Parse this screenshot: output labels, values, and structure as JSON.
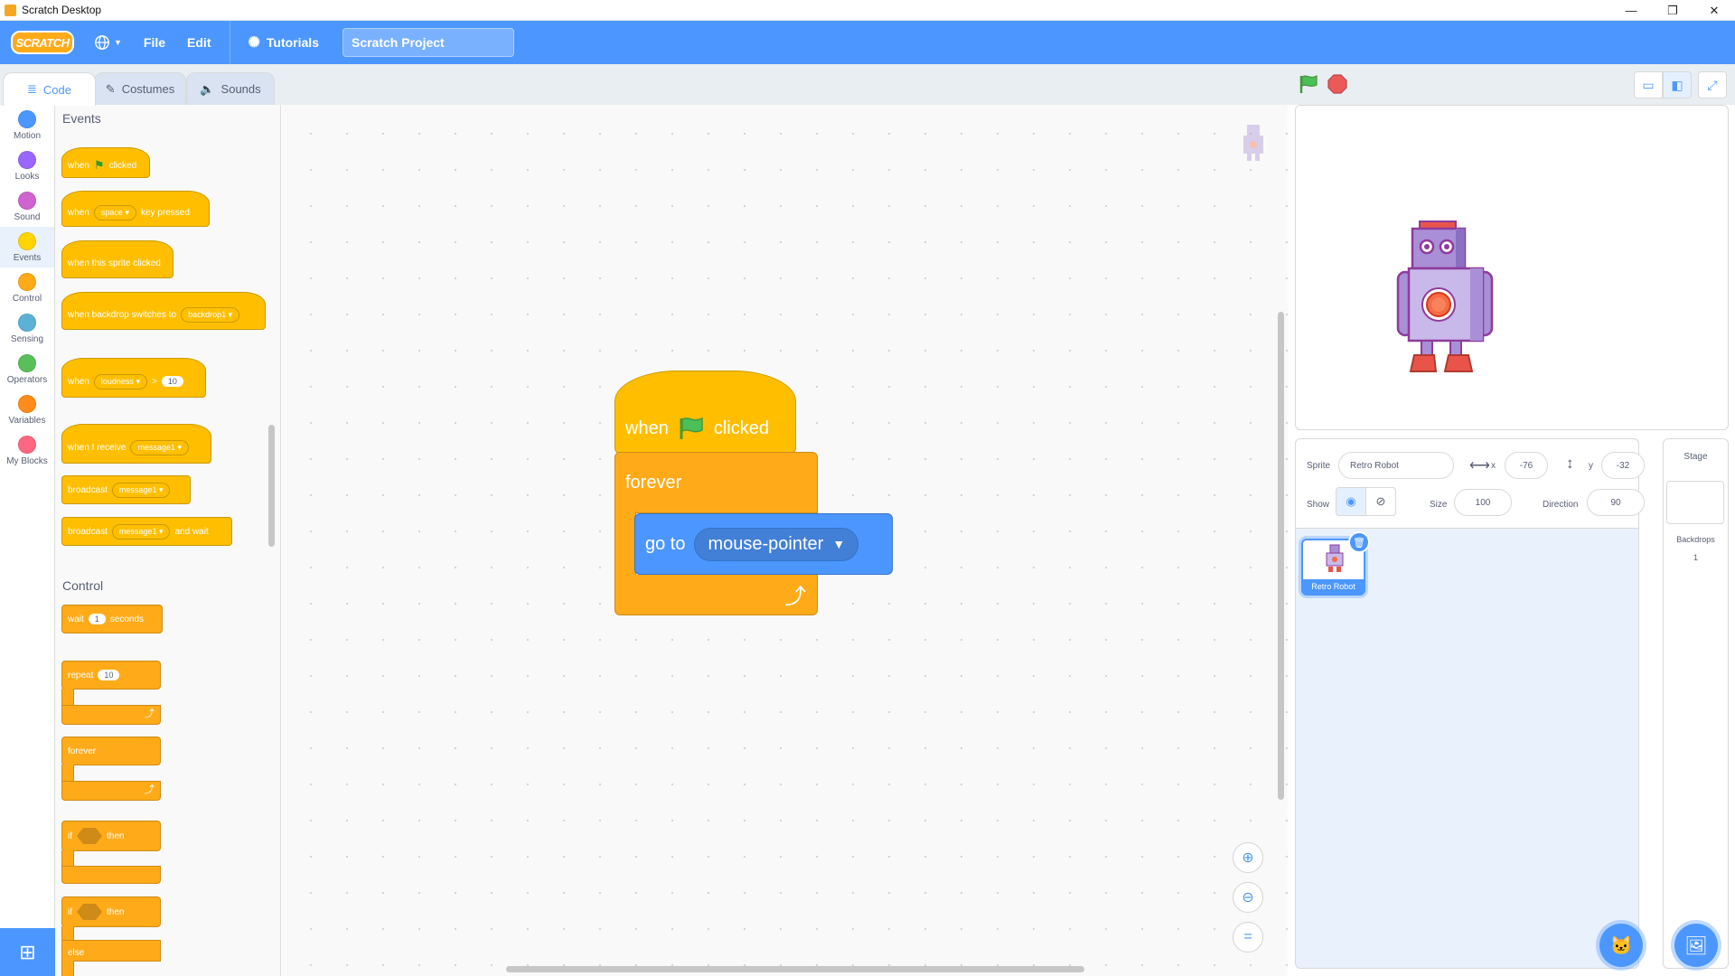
{
  "window": {
    "title": "Scratch Desktop",
    "minimize": "—",
    "restore": "❐",
    "close": "✕"
  },
  "menubar": {
    "logo": "SCRATCH",
    "file": "File",
    "edit": "Edit",
    "tutorials": "Tutorials",
    "project_title": "Scratch Project"
  },
  "tabs": {
    "code": "Code",
    "costumes": "Costumes",
    "sounds": "Sounds"
  },
  "categories": [
    {
      "label": "Motion",
      "color": "#4c97ff"
    },
    {
      "label": "Looks",
      "color": "#9966ff"
    },
    {
      "label": "Sound",
      "color": "#cf63cf"
    },
    {
      "label": "Events",
      "color": "#ffd500"
    },
    {
      "label": "Control",
      "color": "#ffab19"
    },
    {
      "label": "Sensing",
      "color": "#5cb1d6"
    },
    {
      "label": "Operators",
      "color": "#59c059"
    },
    {
      "label": "Variables",
      "color": "#ff8c1a"
    },
    {
      "label": "My Blocks",
      "color": "#ff6680"
    }
  ],
  "palette": {
    "events_title": "Events",
    "control_title": "Control",
    "when": "when",
    "clicked": "clicked",
    "space": "space",
    "key_pressed": "key pressed",
    "when_sprite_clicked": "when this sprite clicked",
    "when_backdrop_switches": "when backdrop switches to",
    "backdrop1": "backdrop1",
    "loudness": "loudness",
    "gt": ">",
    "ten": "10",
    "when_i_receive": "when I receive",
    "message1": "message1",
    "broadcast": "broadcast",
    "and_wait": "and wait",
    "wait": "wait",
    "one": "1",
    "seconds": "seconds",
    "repeat": "repeat",
    "forever": "forever",
    "if": "if",
    "then": "then",
    "else": "else"
  },
  "script": {
    "when": "when",
    "clicked": "clicked",
    "forever": "forever",
    "go_to": "go to",
    "target": "mouse-pointer"
  },
  "sprite_info": {
    "sprite_label": "Sprite",
    "sprite_name": "Retro Robot",
    "x_label": "x",
    "x_value": "-76",
    "y_label": "y",
    "y_value": "-32",
    "show_label": "Show",
    "size_label": "Size",
    "size_value": "100",
    "direction_label": "Direction",
    "direction_value": "90"
  },
  "sprite_list": [
    {
      "name": "Retro Robot"
    }
  ],
  "stage_pane": {
    "title": "Stage",
    "backdrops_label": "Backdrops",
    "backdrops_count": "1"
  },
  "colors": {
    "accent": "#4c97ff",
    "events": "#ffbf00",
    "control": "#ffab19",
    "motion": "#4c97ff"
  }
}
